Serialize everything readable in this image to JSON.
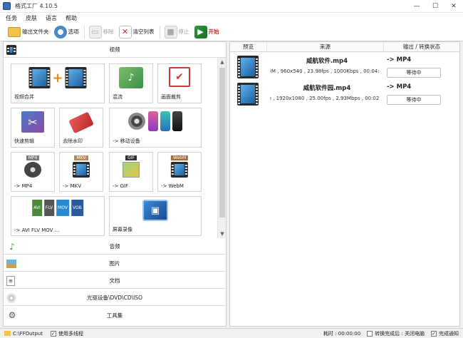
{
  "window": {
    "title": "格式工厂 4.10.5",
    "controls": {
      "minimize": "—",
      "maximize": "☐",
      "close": "✕"
    }
  },
  "menu": [
    "任务",
    "皮肤",
    "语言",
    "帮助"
  ],
  "toolbar": {
    "output_folder": "输出文件夹",
    "options": "选项",
    "remove": "移除",
    "clear_list": "清空列表",
    "stop": "停止",
    "start": "开始"
  },
  "left": {
    "video_header": "视频",
    "tiles": [
      {
        "label": "视频合并"
      },
      {
        "label": "混流"
      },
      {
        "label": "画面裁剪"
      },
      {
        "label": "快速剪辑"
      },
      {
        "label": "去除水印"
      },
      {
        "label": "-> 移动设备"
      },
      {
        "label": "-> MP4",
        "badge": "MP4"
      },
      {
        "label": "-> MKV",
        "badge": "MKV"
      },
      {
        "label": "-> GIF",
        "badge": "GIF"
      },
      {
        "label": "-> WebM",
        "badge": "WebM"
      },
      {
        "label": "-> AVI FLV MOV ...",
        "badges": [
          "AVI",
          "FLV",
          "MOV",
          "VOB"
        ]
      },
      {
        "label": "屏幕录像"
      }
    ],
    "categories": [
      {
        "label": "音频",
        "icon": "music-note-icon"
      },
      {
        "label": "图片",
        "icon": "picture-icon"
      },
      {
        "label": "文档",
        "icon": "document-icon"
      },
      {
        "label": "光驱设备\\DVD\\CD\\ISO",
        "icon": "disc-icon"
      },
      {
        "label": "工具集",
        "icon": "toolbox-icon"
      }
    ]
  },
  "tasks": {
    "columns": [
      "预览",
      "来源",
      "输出 / 转换状态"
    ],
    "rows": [
      {
        "filename": "威航软件.mp4",
        "meta": "iM , 960x540 , 23.98fps , 1000Kbps , 00:04:",
        "target": "-> MP4",
        "status": "等待中"
      },
      {
        "filename": "威航软件园.mp4",
        "meta": "ı , 1920x1080 , 25.00fps , 2.93Mbps , 00:02",
        "target": "-> MP4",
        "status": "等待中"
      }
    ]
  },
  "status": {
    "path": "C:\\FFOutput",
    "multithread": "使用多线程",
    "elapsed": "耗时 : 00:00:00",
    "shutdown": "转换完成后 : 关闭电脑",
    "notify": "完成通知"
  },
  "colors": {
    "accent": "#2a6ebf",
    "film": "#2a2a2a",
    "start_red": "#d9342b",
    "start_green": "#2b9a3a"
  }
}
